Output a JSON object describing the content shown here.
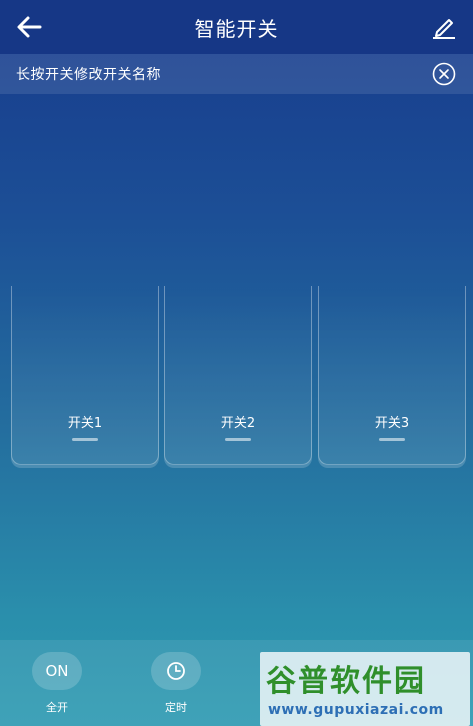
{
  "header": {
    "title": "智能开关"
  },
  "notice": {
    "text": "长按开关修改开关名称"
  },
  "switches": [
    {
      "label": "开关1"
    },
    {
      "label": "开关2"
    },
    {
      "label": "开关3"
    }
  ],
  "bottom": {
    "all_on_icon_text": "ON",
    "all_on_label": "全开",
    "timer_label": "定时"
  },
  "watermark": {
    "brand": "谷普软件园",
    "url": "www.gupuxiazai.com"
  }
}
